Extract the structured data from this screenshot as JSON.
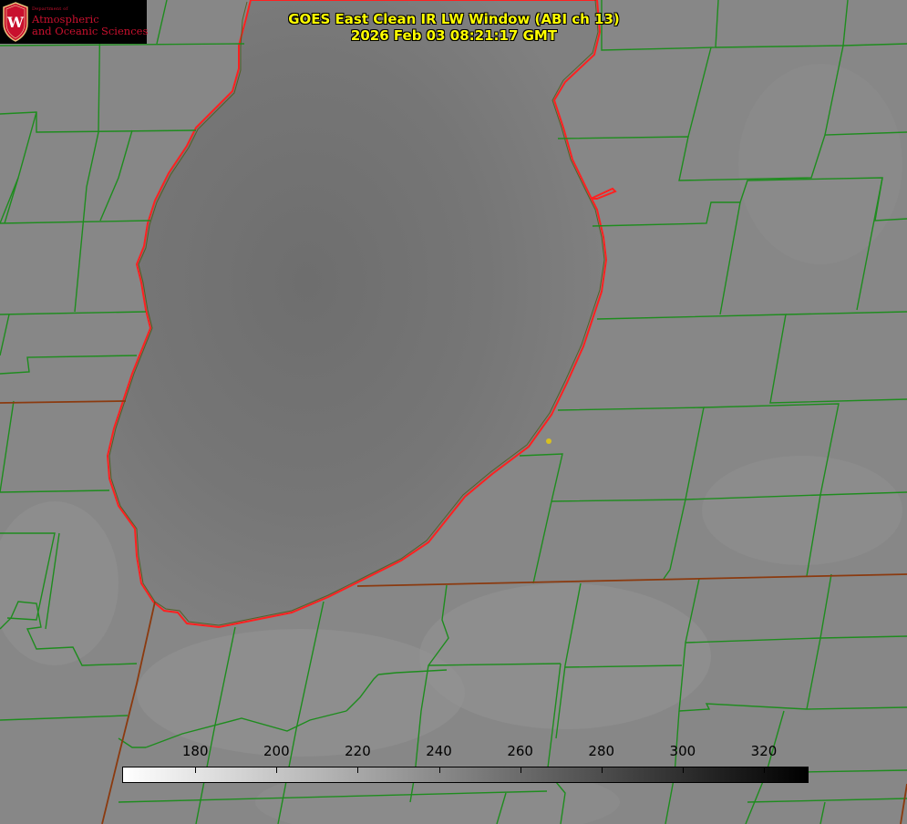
{
  "title": {
    "line1": "GOES East Clean IR LW Window (ABI ch 13)",
    "line2": "2026 Feb 03 08:21:17 GMT"
  },
  "logo": {
    "dept": "Department of",
    "line1": "Atmospheric",
    "line2": "and Oceanic Sciences",
    "seal_letter": "W"
  },
  "colorbar": {
    "min": 162,
    "max": 331,
    "ticks": [
      "180",
      "200",
      "220",
      "240",
      "260",
      "280",
      "300",
      "320"
    ],
    "colormap": "white-to-black grayscale"
  },
  "colors": {
    "county_lines": "#1e8c1e",
    "state_lines": "#8b3a0f",
    "lake_outline": "#ff2020",
    "station_marker": "#d8c020",
    "title_text": "#ffff00",
    "logo_text": "#c8102e"
  }
}
